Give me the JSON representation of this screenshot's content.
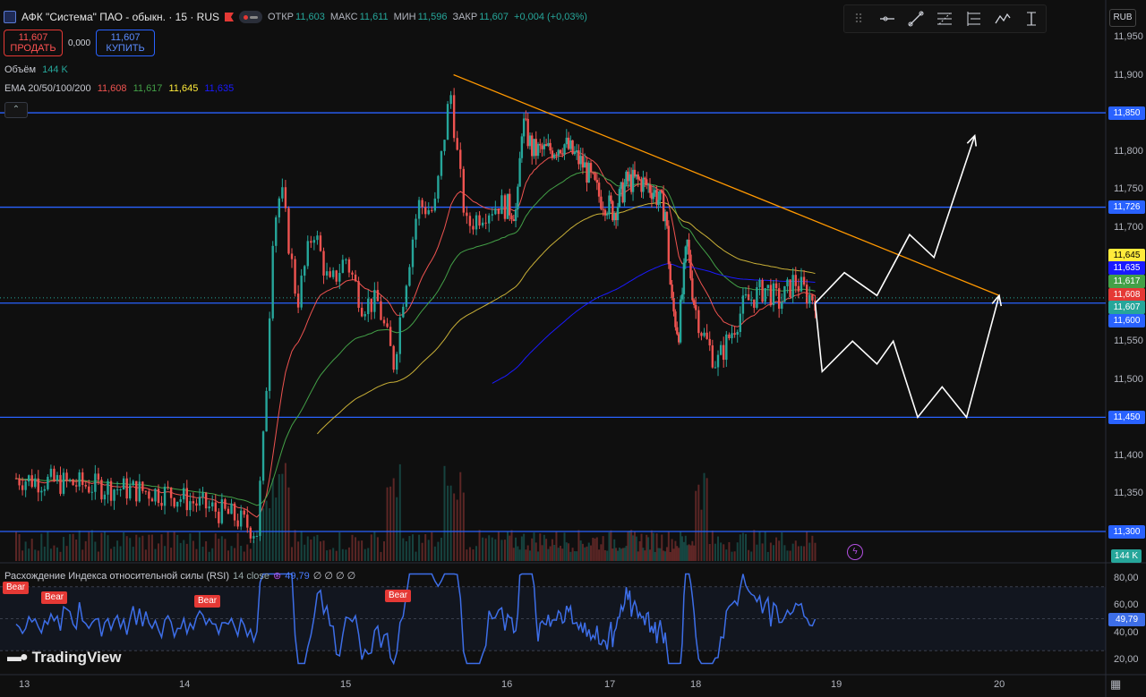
{
  "header": {
    "title": "АФК \"Система\" ПАО - обыкн. · 15 · RUS",
    "ohlc": [
      {
        "k": "ОТКР",
        "v": "11,603"
      },
      {
        "k": "МАКС",
        "v": "11,611"
      },
      {
        "k": "МИН",
        "v": "11,596"
      },
      {
        "k": "ЗАКР",
        "v": "11,607"
      }
    ],
    "change": "+0,004 (+0,03%)"
  },
  "trade": {
    "sell_price": "11,607",
    "sell_label": "ПРОДАТЬ",
    "spread": "0,000",
    "buy_price": "11,607",
    "buy_label": "КУПИТЬ"
  },
  "volume": {
    "label": "Объём",
    "value": "144 K"
  },
  "ema": {
    "label": "EMA 20/50/100/200",
    "v20": "11,608",
    "v50": "11,617",
    "v100": "11,645",
    "v200": "11,635"
  },
  "currency": "RUB",
  "price_axis": [
    "11,950",
    "11,900",
    "11,850",
    "11,800",
    "11,750",
    "11,700",
    "11,650",
    "11,600",
    "11,550",
    "11,500",
    "11,450",
    "11,400",
    "11,350",
    "11,300"
  ],
  "badges": [
    {
      "text": "11,850",
      "bg": "#2962ff",
      "fg": "#ffffff",
      "price": 11.85
    },
    {
      "text": "11,726",
      "bg": "#2962ff",
      "fg": "#ffffff",
      "price": 11.726
    },
    {
      "text": "11,645",
      "bg": "#ffeb3b",
      "fg": "#000000",
      "price": 11.663
    },
    {
      "text": "11,635",
      "bg": "#1a1aff",
      "fg": "#ffffff",
      "price": 11.646
    },
    {
      "text": "11,617",
      "bg": "#43a047",
      "fg": "#ffffff",
      "price": 11.628
    },
    {
      "text": "11,608",
      "bg": "#e53935",
      "fg": "#ffffff",
      "price": 11.611
    },
    {
      "text": "11,607",
      "bg": "#26a69a",
      "fg": "#ffffff",
      "price": 11.594
    },
    {
      "text": "11,600",
      "bg": "#2962ff",
      "fg": "#ffffff",
      "price": 11.577
    },
    {
      "text": "11,450",
      "bg": "#2962ff",
      "fg": "#ffffff",
      "price": 11.45
    },
    {
      "text": "11,300",
      "bg": "#2962ff",
      "fg": "#ffffff",
      "price": 11.3
    }
  ],
  "volume_badge": "144 K",
  "rsi": {
    "label": "Расхождение Индекса относительной силы (RSI)",
    "params": "14 close",
    "value": "49,79",
    "extras": "∅ ∅ ∅ ∅",
    "axis": [
      "80,00",
      "60,00",
      "40,00",
      "20,00"
    ],
    "bear_label": "Bear"
  },
  "x_axis": [
    "13",
    "14",
    "15",
    "16",
    "17",
    "18",
    "19",
    "20"
  ],
  "brand": "TradingView",
  "colors": {
    "up": "#26a69a",
    "down": "#ef5350",
    "level": "#2962ff",
    "trend": "#ff9800",
    "rsi": "#3d6ee8"
  },
  "chart_data": {
    "type": "candlestick",
    "horizontal_levels": [
      11.85,
      11.726,
      11.6,
      11.45,
      11.3
    ],
    "trendline": [
      {
        "x": 15.67,
        "y": 11.9
      },
      {
        "x": 20.0,
        "y": 11.61
      }
    ],
    "ema_last": {
      "ema20": 11.608,
      "ema50": 11.617,
      "ema100": 11.645,
      "ema200": 11.635
    },
    "last_close": 11.607,
    "price_range": [
      11.25,
      11.97
    ],
    "rsi_range": [
      15,
      85
    ],
    "rsi_last": 49.79,
    "price_path": [
      [
        12.95,
        11.37
      ],
      [
        13.9,
        11.35
      ],
      [
        14.3,
        11.32
      ],
      [
        14.45,
        11.3
      ],
      [
        14.5,
        11.45
      ],
      [
        14.55,
        11.7
      ],
      [
        14.6,
        11.75
      ],
      [
        14.7,
        11.6
      ],
      [
        14.8,
        11.7
      ],
      [
        14.9,
        11.62
      ],
      [
        15.0,
        11.66
      ],
      [
        15.1,
        11.6
      ],
      [
        15.2,
        11.6
      ],
      [
        15.3,
        11.52
      ],
      [
        15.35,
        11.6
      ],
      [
        15.45,
        11.73
      ],
      [
        15.55,
        11.72
      ],
      [
        15.65,
        11.88
      ],
      [
        15.7,
        11.78
      ],
      [
        15.75,
        11.7
      ],
      [
        15.85,
        11.72
      ],
      [
        15.95,
        11.73
      ],
      [
        16.1,
        11.72
      ],
      [
        16.15,
        11.84
      ],
      [
        16.25,
        11.8
      ],
      [
        16.4,
        11.8
      ],
      [
        16.55,
        11.81
      ],
      [
        16.75,
        11.78
      ],
      [
        16.9,
        11.74
      ],
      [
        17.05,
        11.72
      ],
      [
        17.2,
        11.76
      ],
      [
        17.35,
        11.76
      ],
      [
        17.5,
        11.75
      ],
      [
        17.65,
        11.72
      ],
      [
        17.72,
        11.6
      ],
      [
        17.8,
        11.56
      ],
      [
        17.9,
        11.68
      ],
      [
        17.97,
        11.61
      ],
      [
        18.05,
        11.56
      ],
      [
        18.15,
        11.52
      ],
      [
        18.25,
        11.56
      ],
      [
        18.35,
        11.6
      ],
      [
        18.5,
        11.62
      ],
      [
        18.6,
        11.6
      ],
      [
        18.7,
        11.63
      ],
      [
        18.8,
        11.61
      ],
      [
        18.85,
        11.607
      ]
    ],
    "projection_up": [
      [
        18.85,
        11.6
      ],
      [
        19.05,
        11.64
      ],
      [
        19.25,
        11.61
      ],
      [
        19.45,
        11.69
      ],
      [
        19.6,
        11.66
      ],
      [
        19.85,
        11.82
      ]
    ],
    "projection_down": [
      [
        18.85,
        11.6
      ],
      [
        18.9,
        11.51
      ],
      [
        19.1,
        11.55
      ],
      [
        19.25,
        11.52
      ],
      [
        19.35,
        11.55
      ],
      [
        19.5,
        11.45
      ],
      [
        19.65,
        11.49
      ],
      [
        19.8,
        11.45
      ],
      [
        20.0,
        11.61
      ]
    ]
  }
}
